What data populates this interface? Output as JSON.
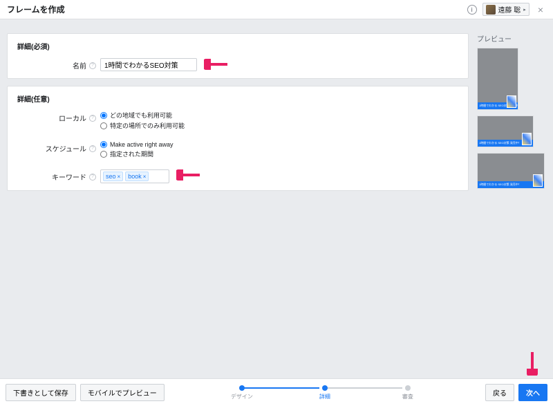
{
  "header": {
    "title": "フレームを作成",
    "user_name": "遠藤 聡"
  },
  "panels": {
    "required_title": "詳細(必須)",
    "optional_title": "詳細(任意)"
  },
  "fields": {
    "name_label": "名前",
    "name_value": "1時間でわかるSEO対策",
    "local_label": "ローカル",
    "local_opt1": "どの地域でも利用可能",
    "local_opt2": "特定の場所でのみ利用可能",
    "schedule_label": "スケジュール",
    "schedule_opt1": "Make active right away",
    "schedule_opt2": "指定された期間",
    "keyword_label": "キーワード",
    "keyword_tags": [
      "seo",
      "book"
    ]
  },
  "preview": {
    "title": "プレビュー",
    "banner_text": "1時間でわかる SEO対策 発売中！"
  },
  "footer": {
    "save_draft": "下書きとして保存",
    "mobile_preview": "モバイルでプレビュー",
    "back": "戻る",
    "next": "次へ",
    "steps": [
      "デザイン",
      "詳細",
      "審査"
    ]
  },
  "colors": {
    "accent": "#1877f2",
    "arrow": "#e91e63"
  }
}
